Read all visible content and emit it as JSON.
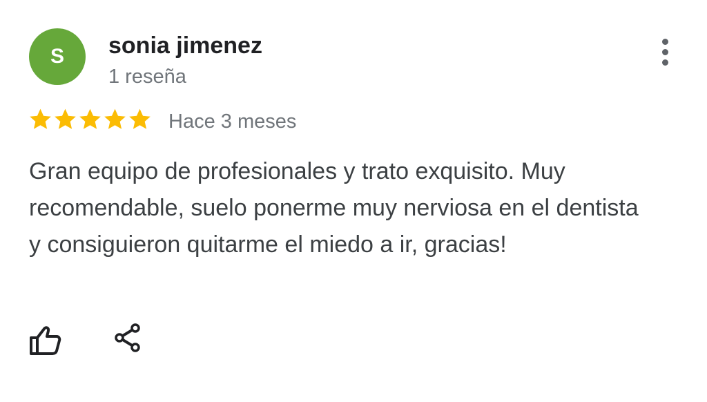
{
  "reviewer": {
    "avatar_initial": "S",
    "avatar_color": "#66a83a",
    "name": "sonia jimenez",
    "review_count": "1 reseña"
  },
  "menu": {
    "icon": "more-vert-icon"
  },
  "rating": {
    "stars": 5,
    "max_stars": 5,
    "star_color": "#fbbc04",
    "time_ago": "Hace 3 meses"
  },
  "review": {
    "text": "Gran equipo de profesionales y trato exquisito. Muy recomendable, suelo ponerme muy nerviosa en el dentista y consiguieron quitarme el miedo a ir, gracias!"
  },
  "actions": {
    "like_icon": "thumb-up-icon",
    "share_icon": "share-icon"
  }
}
